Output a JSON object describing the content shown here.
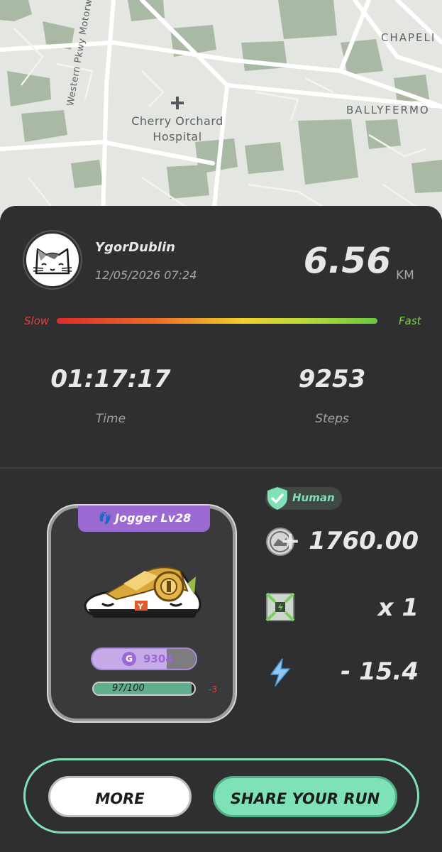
{
  "map": {
    "labels": {
      "hospital_line1": "Cherry Orchard",
      "hospital_line2": "Hospital",
      "road": "Western Pkwy Motorway",
      "area1": "CHAPELI",
      "area2": "BALLYFERMO"
    }
  },
  "run": {
    "username": "YgorDublin",
    "datetime": "12/05/2026 07:24",
    "distance": "6.56",
    "distance_unit": "KM",
    "speed": {
      "slow_label": "Slow",
      "fast_label": "Fast"
    },
    "time_value": "01:17:17",
    "time_label": "Time",
    "steps_value": "9253",
    "steps_label": "Steps"
  },
  "sneaker": {
    "tag": "Jogger Lv28",
    "gmt_badge": "G",
    "gmt_value": "9304",
    "gmt_fill_fraction": 0.72,
    "durability_text": "97/100",
    "durability_fraction": 0.97,
    "durability_loss": "-3"
  },
  "rewards": {
    "human_label": "Human",
    "gst_value": "+ 1760.00",
    "mystery_box_value": "x 1",
    "energy_value": "- 15.4"
  },
  "buttons": {
    "more": "MORE",
    "share": "SHARE YOUR RUN"
  },
  "colors": {
    "accent_green": "#7fe2b6",
    "sneaker_purple": "#9a6ad2",
    "card_bg": "#2f2f31",
    "slow_red": "#e0413a",
    "fast_green": "#7dd04b"
  }
}
